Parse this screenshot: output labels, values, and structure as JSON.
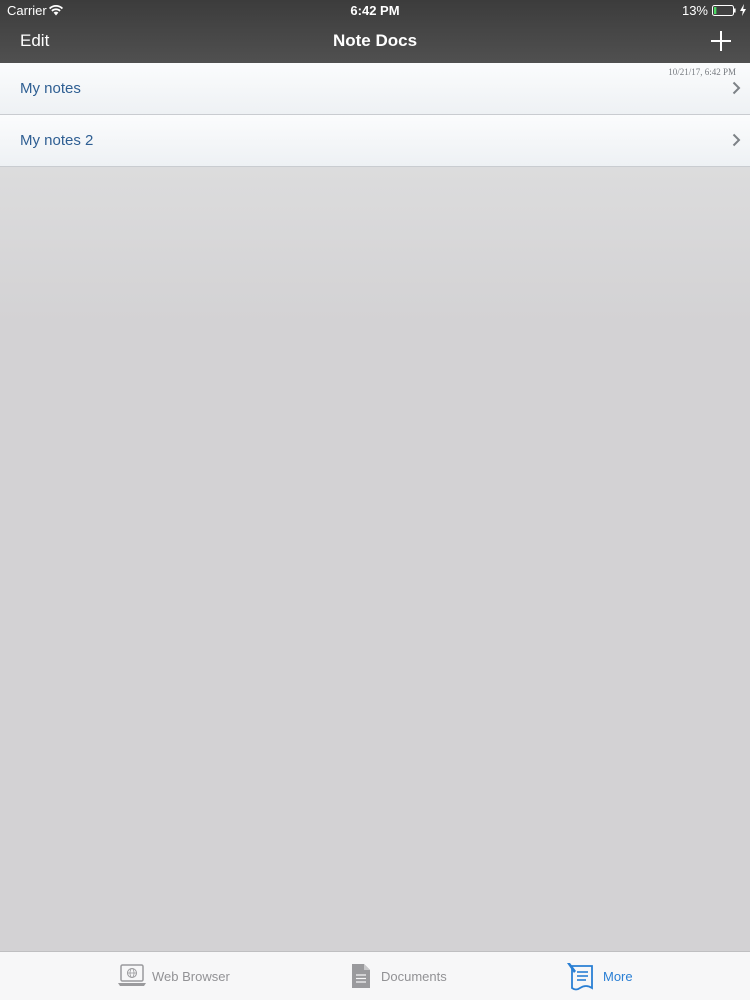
{
  "status_bar": {
    "carrier": "Carrier",
    "time": "6:42 PM",
    "battery_percent": "13%",
    "battery_level": 0.13,
    "battery_color": "#4cd964",
    "wifi_icon": "wifi-icon",
    "charging_icon": "bolt-icon"
  },
  "nav": {
    "edit_label": "Edit",
    "title": "Note Docs",
    "add_icon": "plus-icon"
  },
  "notes": [
    {
      "label": "My notes",
      "timestamp": "10/21/17, 6:42 PM"
    },
    {
      "label": "My notes 2",
      "timestamp": ""
    }
  ],
  "tabs": [
    {
      "label": "Web Browser",
      "icon": "laptop-globe-icon",
      "selected": false
    },
    {
      "label": "Documents",
      "icon": "document-icon",
      "selected": false
    },
    {
      "label": "More",
      "icon": "notes-pen-icon",
      "selected": true
    }
  ],
  "colors": {
    "accent": "#2a7fd4",
    "nav_background": "#474747",
    "list_text": "#2f5f93",
    "tab_inactive": "#929295"
  }
}
